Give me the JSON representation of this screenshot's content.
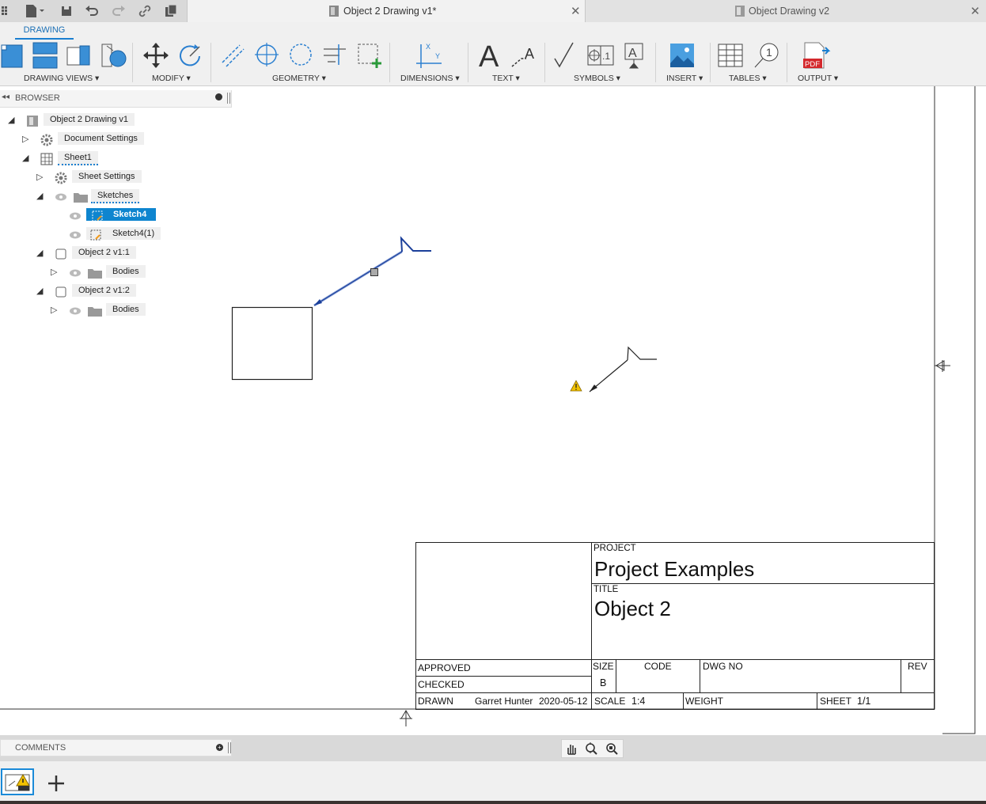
{
  "tabs": {
    "active": {
      "label": "Object 2 Drawing v1*"
    },
    "inactive": {
      "label": "Object Drawing v2"
    },
    "close_glyph": "✕"
  },
  "workspace_tab": "DRAWING",
  "ribbon_groups": [
    {
      "label": "DRAWING VIEWS ▾"
    },
    {
      "label": "MODIFY ▾"
    },
    {
      "label": "GEOMETRY ▾"
    },
    {
      "label": "DIMENSIONS ▾"
    },
    {
      "label": "TEXT ▾"
    },
    {
      "label": "SYMBOLS ▾"
    },
    {
      "label": "INSERT ▾"
    },
    {
      "label": "TABLES ▾"
    },
    {
      "label": "OUTPUT ▾"
    }
  ],
  "ribbon_icon_text": {
    "text_a": "A",
    "leader_a": "A",
    "pdf": "PDF",
    "balloon": "1",
    "symbol_box": "A",
    "datum_text": ".1",
    "dim_x": "X",
    "dim_y": "Y"
  },
  "browser": {
    "title": "BROWSER",
    "items": [
      {
        "label": "Object 2 Drawing v1"
      },
      {
        "label": "Document Settings"
      },
      {
        "label": "Sheet1"
      },
      {
        "label": "Sheet Settings"
      },
      {
        "label": "Sketches"
      },
      {
        "label": "Sketch4"
      },
      {
        "label": "Sketch4(1)"
      },
      {
        "label": "Object 2 v1:1"
      },
      {
        "label": "Bodies"
      },
      {
        "label": "Object 2 v1:2"
      },
      {
        "label": "Bodies"
      }
    ]
  },
  "comments": {
    "title": "COMMENTS"
  },
  "title_block": {
    "project_label": "PROJECT",
    "project": "Project Examples",
    "title_label": "TITLE",
    "title": "Object 2",
    "approved": "APPROVED",
    "checked": "CHECKED",
    "drawn": "DRAWN",
    "drawn_by": "Garret Hunter",
    "drawn_date": "2020-05-12",
    "size_label": "SIZE",
    "size": "B",
    "code_label": "CODE",
    "dwg_label": "DWG NO",
    "rev_label": "REV",
    "scale_label": "SCALE",
    "scale": "1:4",
    "weight_label": "WEIGHT",
    "sheet_label": "SHEET",
    "sheet": "1/1"
  },
  "colors": {
    "accent": "#1a7fd0",
    "selection": "#0e85cf",
    "leader_selected": "#2a55b8",
    "warning": "#f2c200"
  },
  "icons": [
    "grid-menu-icon",
    "file-icon",
    "save-icon",
    "undo-icon",
    "redo-icon",
    "link-icon",
    "data-panel-icon",
    "base-view-icon",
    "projected-view-icon",
    "section-view-icon",
    "detail-view-icon",
    "move-icon",
    "rotate-icon",
    "centerline-icon",
    "center-mark-icon",
    "center-mark-pattern-icon",
    "edge-extension-icon",
    "sketch-add-icon",
    "dimension-icon",
    "text-icon",
    "leader-icon",
    "surface-texture-icon",
    "datum-identifier-icon",
    "feature-control-icon",
    "insert-image-icon",
    "table-icon",
    "balloon-icon",
    "pdf-icon",
    "gear-icon",
    "eye-icon",
    "folder-icon",
    "sketch-icon",
    "component-icon",
    "warning-icon",
    "pan-icon",
    "zoom-icon",
    "zoom-window-icon",
    "add-sheet-icon"
  ]
}
